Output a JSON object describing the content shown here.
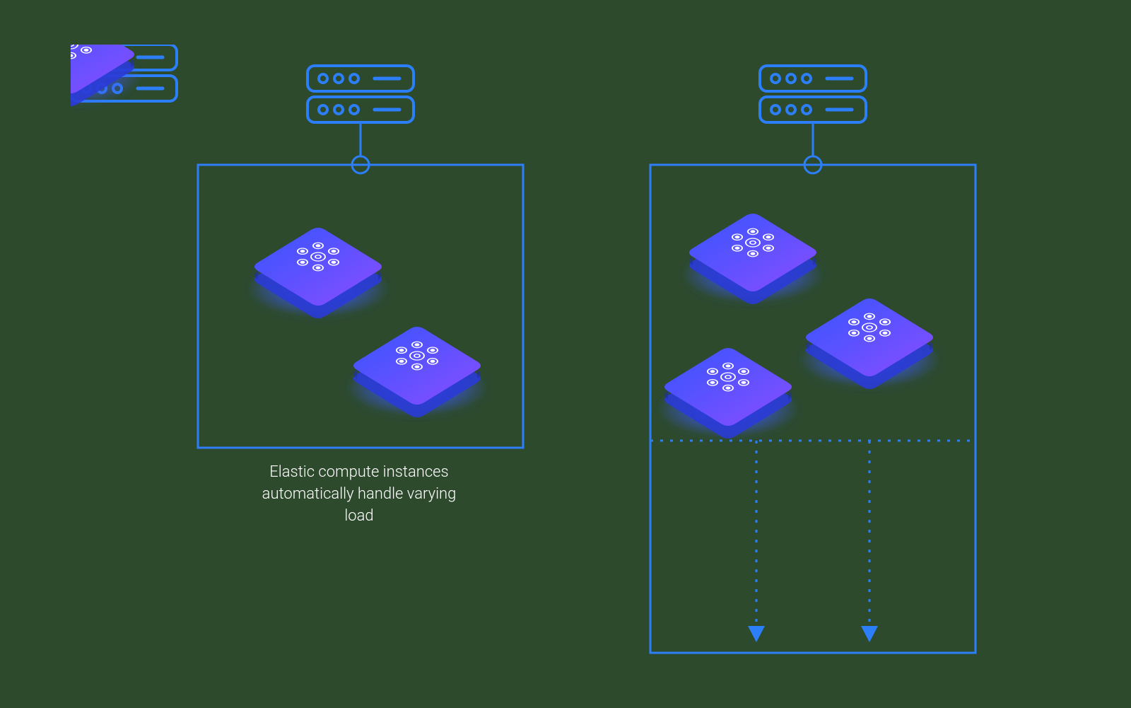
{
  "diagram": {
    "left_panel": {
      "caption": "Elastic compute instances automatically handle varying load"
    },
    "colors": {
      "stroke": "#2d7ff9",
      "node_gradient_start": "#3d5afe",
      "node_gradient_end": "#7c4dff",
      "glow": "#3d5afe",
      "background": "#2d4a2d",
      "text": "#ffffff"
    }
  }
}
